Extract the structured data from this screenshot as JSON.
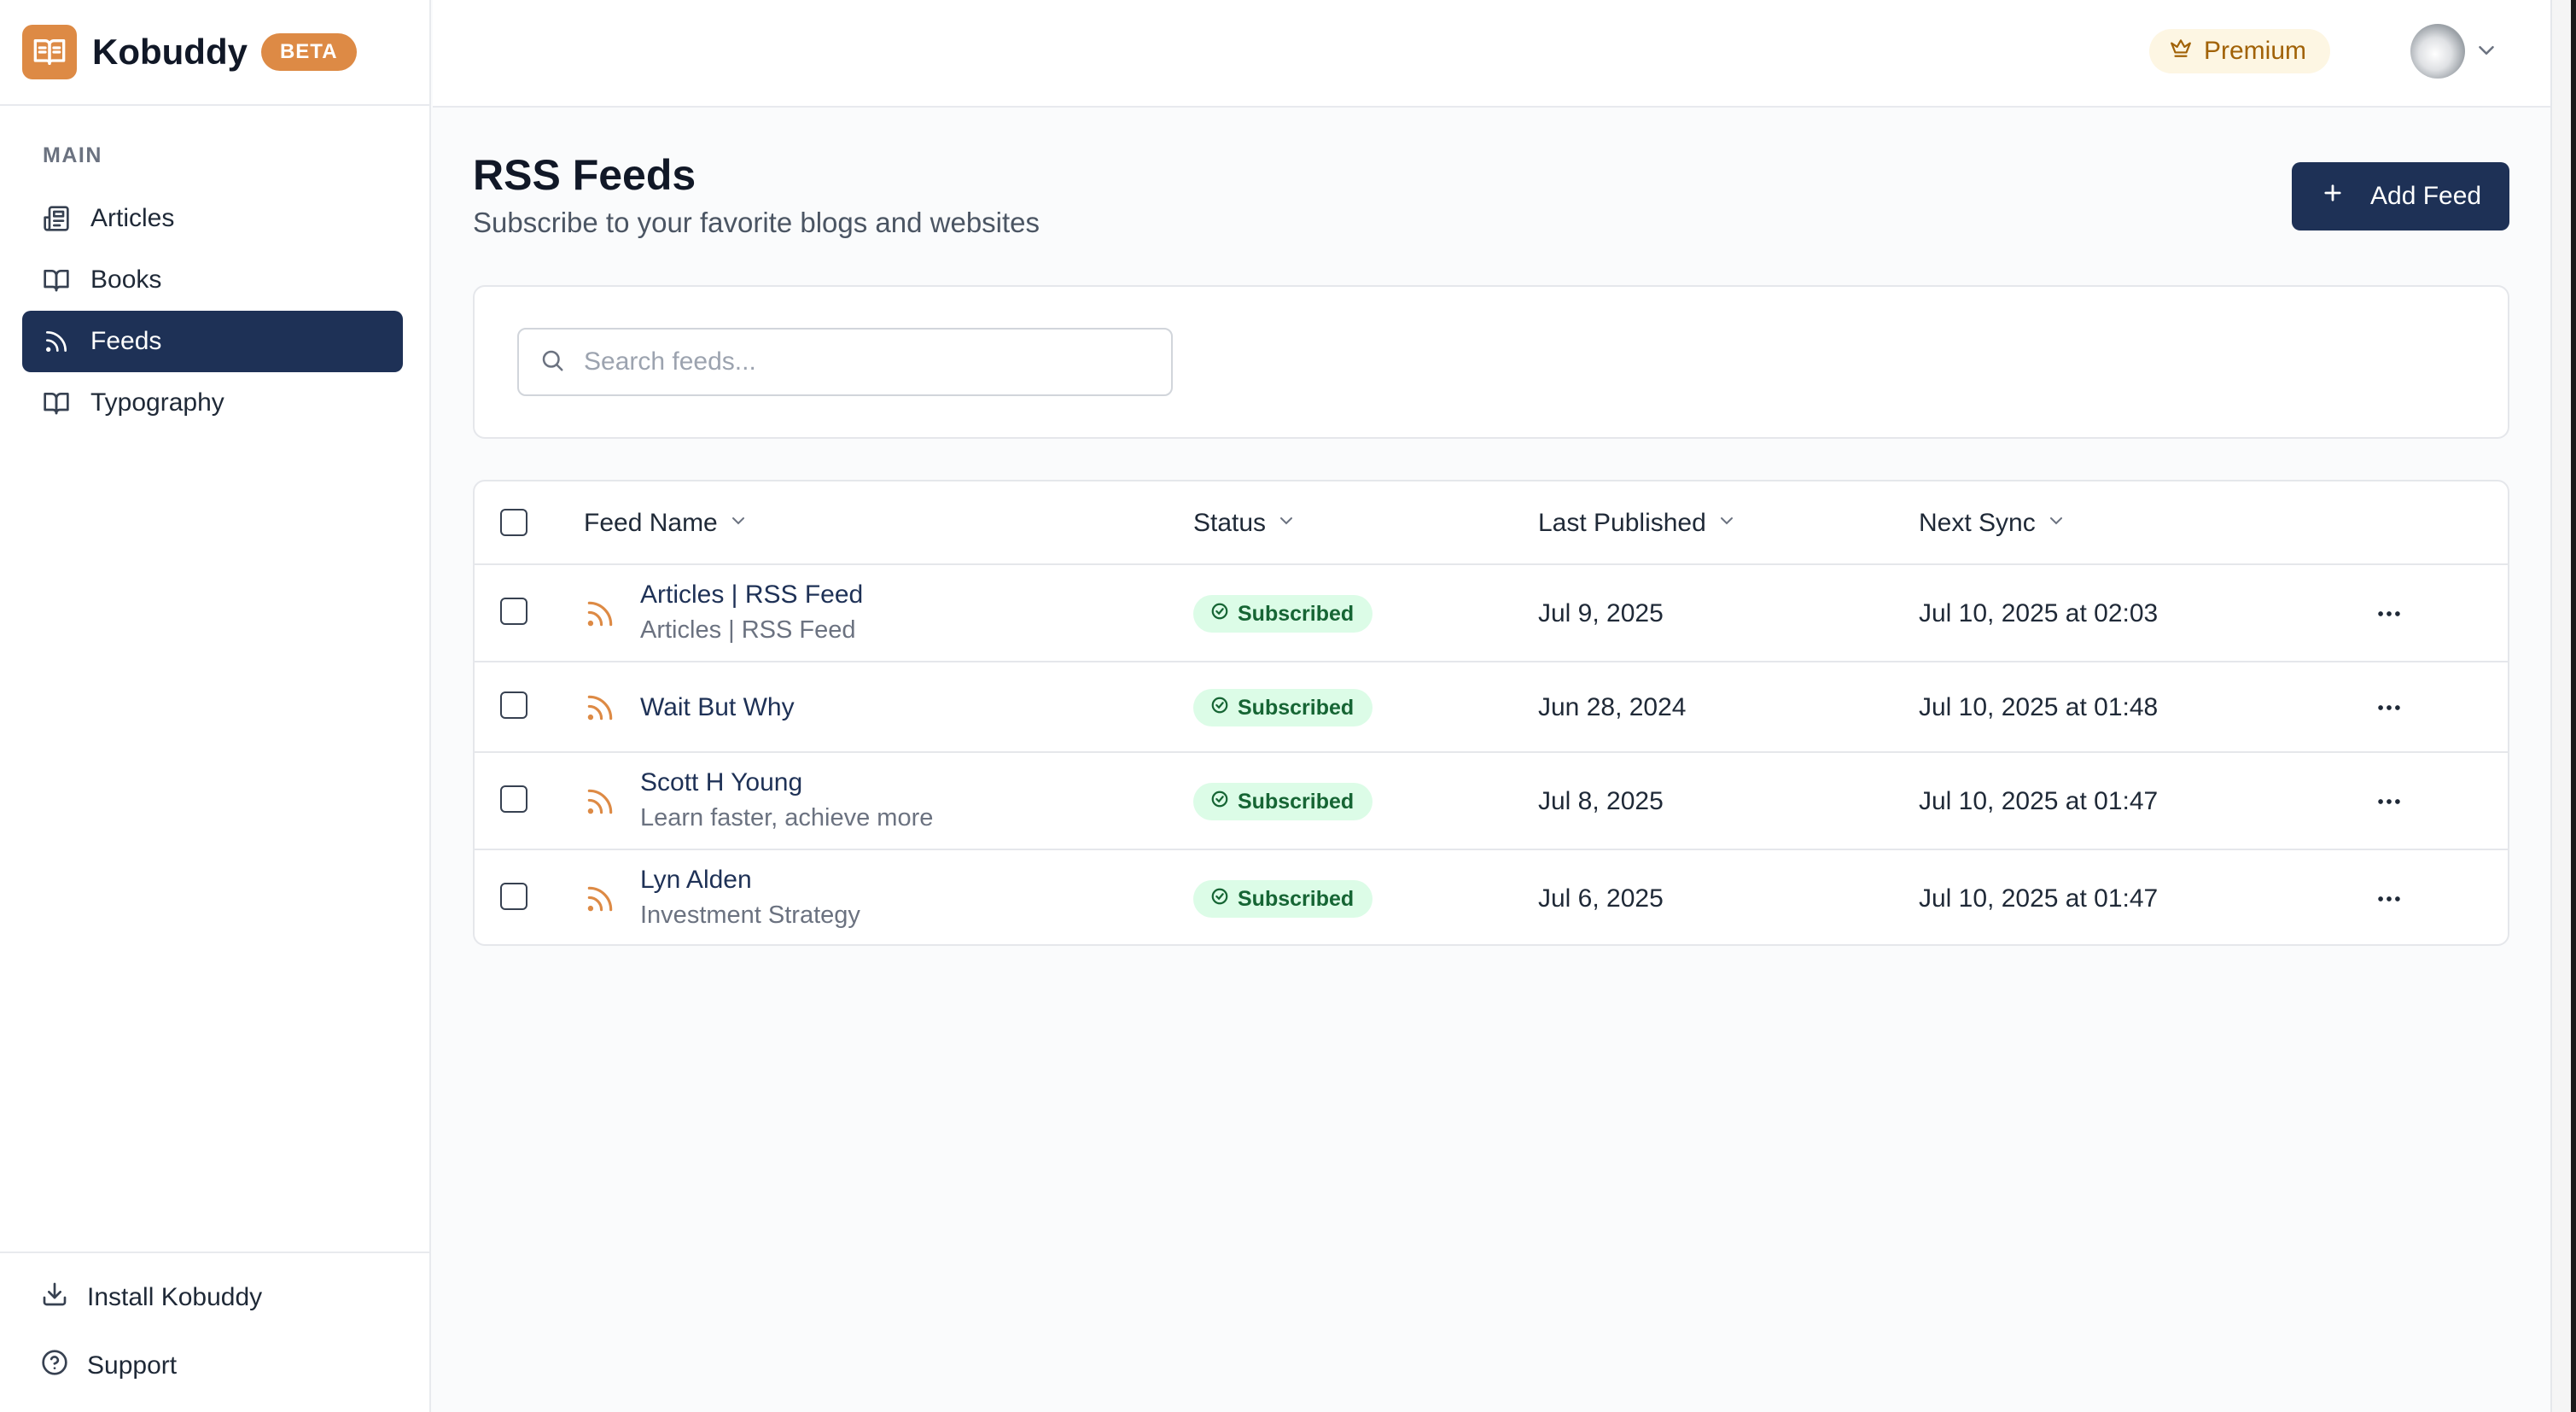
{
  "app": {
    "name": "Kobuddy",
    "badge": "BETA"
  },
  "sidebar": {
    "section": "MAIN",
    "items": [
      {
        "label": "Articles",
        "icon": "newspaper-icon"
      },
      {
        "label": "Books",
        "icon": "book-open-icon"
      },
      {
        "label": "Feeds",
        "icon": "rss-icon",
        "active": true
      },
      {
        "label": "Typography",
        "icon": "book-open-icon"
      }
    ],
    "bottom": [
      {
        "label": "Install Kobuddy",
        "icon": "download-icon"
      },
      {
        "label": "Support",
        "icon": "help-circle-icon"
      }
    ]
  },
  "header": {
    "premium_label": "Premium"
  },
  "page": {
    "title": "RSS Feeds",
    "subtitle": "Subscribe to your favorite blogs and websites",
    "add_button": "Add Feed"
  },
  "search": {
    "placeholder": "Search feeds...",
    "value": ""
  },
  "table": {
    "columns": [
      "Feed Name",
      "Status",
      "Last Published",
      "Next Sync"
    ],
    "rows": [
      {
        "name": "Articles | RSS Feed",
        "desc": "Articles | RSS Feed",
        "status": "Subscribed",
        "last_published": "Jul 9, 2025",
        "next_sync": "Jul 10, 2025 at 02:03"
      },
      {
        "name": "Wait But Why",
        "desc": "",
        "status": "Subscribed",
        "last_published": "Jun 28, 2024",
        "next_sync": "Jul 10, 2025 at 01:48"
      },
      {
        "name": "Scott H Young",
        "desc": "Learn faster, achieve more",
        "status": "Subscribed",
        "last_published": "Jul 8, 2025",
        "next_sync": "Jul 10, 2025 at 01:47"
      },
      {
        "name": "Lyn Alden",
        "desc": "Investment Strategy",
        "status": "Subscribed",
        "last_published": "Jul 6, 2025",
        "next_sync": "Jul 10, 2025 at 01:47"
      }
    ]
  },
  "colors": {
    "brand": "#dd8a45",
    "primary": "#1e3156",
    "success_bg": "#dcfce7",
    "success_text": "#166534",
    "premium_text": "#a16207"
  }
}
